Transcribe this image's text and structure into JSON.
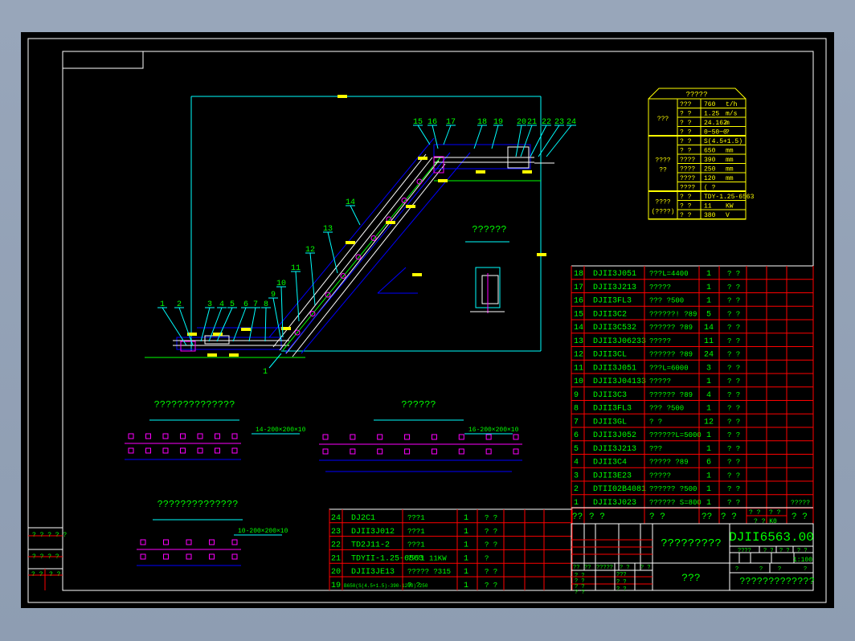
{
  "colors": {
    "text_green": "#00ff00",
    "spec_yellow": "#ffff00",
    "grid_red": "#ff0000",
    "frame_white": "#ffffff",
    "cyan": "#00ffff",
    "blue": "#0000ff",
    "magenta": "#ff00ff"
  },
  "callouts": [
    "1",
    "2",
    "3",
    "4",
    "5",
    "6",
    "7",
    "8",
    "9",
    "10",
    "11",
    "12",
    "13",
    "14",
    "15",
    "16",
    "17",
    "18",
    "19",
    "20",
    "21",
    "22",
    "23",
    "24"
  ],
  "callout_extra": "1",
  "sections": {
    "title_a": "??????????????",
    "title_b": "??????",
    "title_c": "??????????????",
    "title_d": "??????",
    "label_a": "14-200×200×10",
    "label_b": "16-200×200×10",
    "label_c": "10-200×200×10"
  },
  "spec_table": {
    "title": "?????",
    "groups": [
      {
        "label": [
          "???"
        ],
        "rows": [
          [
            "???",
            "760",
            "t/h"
          ],
          [
            "? ?",
            "1.25",
            "m/s"
          ],
          [
            "? ?",
            "24.162",
            "m"
          ],
          [
            "? ?",
            "0~50~0",
            "?"
          ]
        ]
      },
      {
        "label": [
          "????",
          "??"
        ],
        "rows": [
          [
            "? ?",
            "S(4.5+1.5)",
            ""
          ],
          [
            "? ?",
            "650",
            "mm"
          ],
          [
            "????",
            "390",
            "mm"
          ],
          [
            "????",
            "250",
            "mm"
          ],
          [
            "????",
            "120",
            "mm"
          ],
          [
            "????",
            "( ?",
            ""
          ]
        ]
      },
      {
        "label": [
          "????",
          "(????)"
        ],
        "rows": [
          [
            "? ?",
            "TDY-1.25-6563",
            ""
          ],
          [
            "? ?",
            "11",
            "KW"
          ],
          [
            "? ?",
            "380",
            "V"
          ]
        ]
      }
    ]
  },
  "parts_table": {
    "rows": [
      [
        "18",
        "DJII3J051",
        "???L=4400",
        "1",
        "? ?",
        ""
      ],
      [
        "17",
        "DJII3J213",
        "?????",
        "1",
        "? ?",
        ""
      ],
      [
        "16",
        "DJII3FL3",
        "??? ?500",
        "1",
        "? ?",
        ""
      ],
      [
        "15",
        "DJII3C2",
        "??????! ?89",
        "5",
        "? ?",
        ""
      ],
      [
        "14",
        "DJII3C532",
        "?????? ?89",
        "14",
        "? ?",
        ""
      ],
      [
        "13",
        "DJII3J06233",
        "?????",
        "11",
        "? ?",
        ""
      ],
      [
        "12",
        "DJII3CL",
        "?????? ?89",
        "24",
        "? ?",
        ""
      ],
      [
        "11",
        "DJII3J051",
        "???L=6000",
        "3",
        "? ?",
        ""
      ],
      [
        "10",
        "DJII3J04133",
        "?????",
        "1",
        "? ?",
        ""
      ],
      [
        "9",
        "DJII3C3",
        "?????? ?89",
        "4",
        "? ?",
        ""
      ],
      [
        "8",
        "DJII3FL3",
        "??? ?500",
        "1",
        "? ?",
        ""
      ],
      [
        "7",
        "DJII3GL",
        "?   ?",
        "12",
        "? ?",
        ""
      ],
      [
        "6",
        "DJII3J052",
        "??????L=5000",
        "1",
        "? ?",
        ""
      ],
      [
        "5",
        "DJII3J213",
        "???",
        "1",
        "? ?",
        ""
      ],
      [
        "4",
        "DJII3C4",
        "????? ?89",
        "6",
        "? ?",
        ""
      ],
      [
        "3",
        "DJII3E23",
        "?????",
        "1",
        "? ?",
        ""
      ],
      [
        "2",
        "DTII02B4081",
        "?????? ?500",
        "1",
        "? ?",
        ""
      ],
      [
        "1",
        "DJII3J023",
        "?????? S=800",
        "1",
        "? ?",
        "?????"
      ]
    ],
    "header": {
      "no": "??",
      "code": "?     ?",
      "name": "?       ?",
      "qty": "??",
      "material": "?  ?",
      "unit_top": "? ?",
      "total_top": "? ?",
      "unit_weight": "? ?  K0",
      "remark": "?  ?"
    }
  },
  "bottom_table": {
    "rows": [
      [
        "24",
        "DJ2C1",
        "???1",
        "1",
        "? ?"
      ],
      [
        "23",
        "DJII3J012",
        "???1",
        "1",
        "? ?"
      ],
      [
        "22",
        "TD2J11-2",
        "???1",
        "1",
        "? ?"
      ],
      [
        "21",
        "TDYII-1.25-6563",
        "???1   11KW",
        "1",
        "?"
      ],
      [
        "20",
        "DJII3JE13",
        "????? ?315",
        "1",
        "? ?"
      ],
      [
        "19",
        "B650(S(4.5+1.5)-390-1200)-250",
        "? ?",
        "1",
        "? ?"
      ]
    ]
  },
  "title_block": {
    "drawing_no": "DJII6563.00",
    "drawing_name": "?????????",
    "company": "???",
    "scale": "1:100",
    "bottom_label": "?????????????",
    "stage_labels": [
      "????",
      "? ?",
      "? ?",
      "? ?"
    ],
    "sheet_labels": [
      "?",
      "?",
      "?",
      "?"
    ],
    "left_labels": [
      "??",
      "??",
      "?????",
      "? ?",
      "? ?"
    ],
    "sign_labels": [
      "? ?",
      "? ?",
      "? ?",
      "? ?"
    ],
    "sign_right": [
      "???",
      "? ?",
      "? ?"
    ]
  },
  "margin": {
    "a": "? ? ? ? ?",
    "b": "? ? ? ?",
    "c": "? ?",
    "d": "? ?"
  }
}
